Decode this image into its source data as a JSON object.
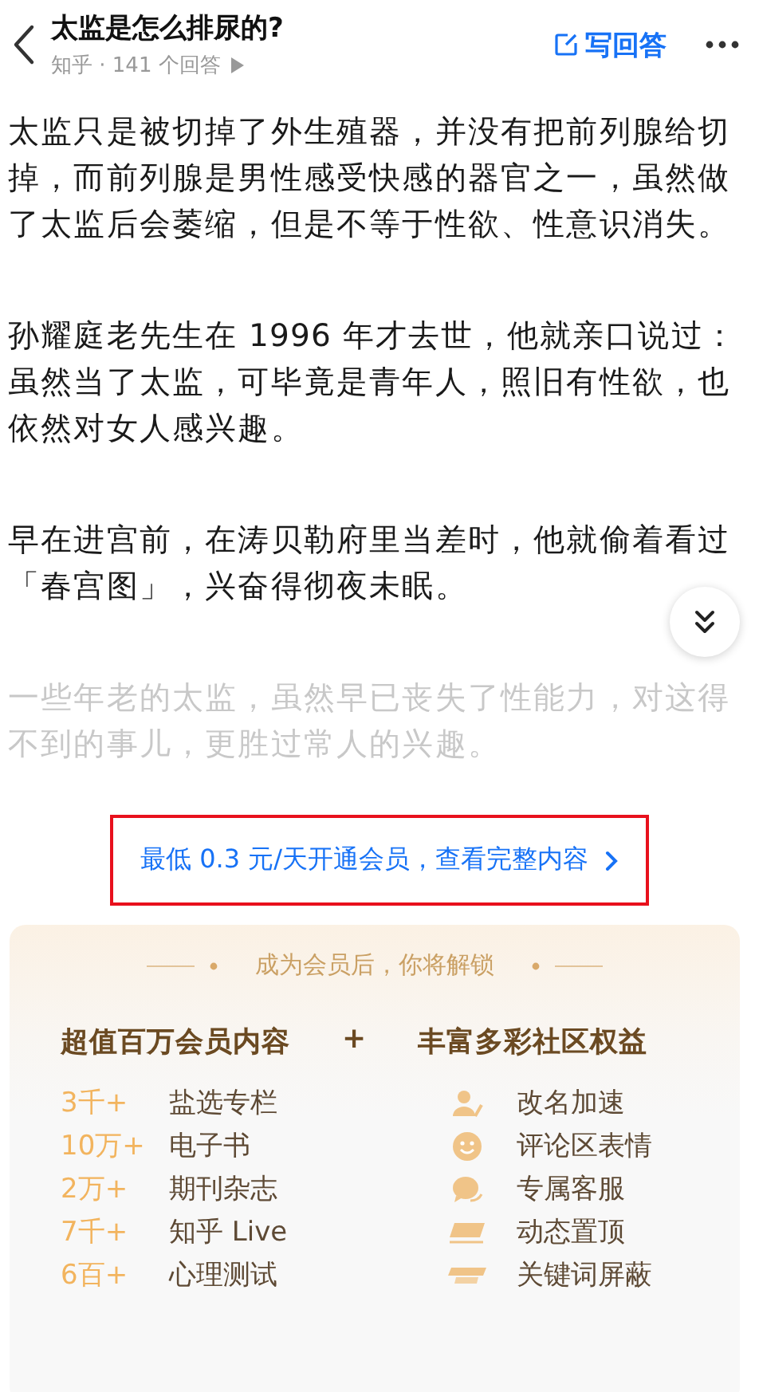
{
  "header": {
    "title": "太监是怎么排尿的?",
    "subtitle": "知乎 · 141 个回答",
    "write_answer": "写回答"
  },
  "paragraphs": [
    {
      "text": "太监只是被切掉了外生殖器，并没有把前列腺给切掉，而前列腺是男性感受快感的器官之一，虽然做了太监后会萎缩，但是不等于性欲、性意识消失。",
      "faded": false
    },
    {
      "text": "孙耀庭老先生在 1996 年才去世，他就亲口说过：虽然当了太监，可毕竟是青年人，照旧有性欲，也依然对女人感兴趣。",
      "faded": false
    },
    {
      "text": "早在进宫前，在涛贝勒府里当差时，他就偷着看过「春宫图」，兴奋得彻夜未眠。",
      "faded": false
    },
    {
      "text": "一些年老的太监，虽然早已丧失了性能力，对这得不到的事儿，更胜过常人的兴趣。",
      "faded": true
    }
  ],
  "unlock_link": {
    "text": "最低 0.3 元/天开通会员，查看完整内容",
    "highlighted": true
  },
  "membership": {
    "heading": "成为会员后，你将解锁",
    "left_title": "超值百万会员内容",
    "plus": "+",
    "right_title": "丰富多彩社区权益",
    "content": [
      {
        "count": "3千+",
        "label": "盐选专栏"
      },
      {
        "count": "10万+",
        "label": "电子书"
      },
      {
        "count": "2万+",
        "label": "期刊杂志"
      },
      {
        "count": "7千+",
        "label": "知乎 Live"
      },
      {
        "count": "6百+",
        "label": "心理测试"
      }
    ],
    "perks": [
      {
        "kind": "user",
        "label": "改名加速"
      },
      {
        "kind": "smile",
        "label": "评论区表情"
      },
      {
        "kind": "chat",
        "label": "专属客服"
      },
      {
        "kind": "top",
        "label": "动态置顶"
      },
      {
        "kind": "key",
        "label": "关键词屏蔽"
      }
    ]
  }
}
